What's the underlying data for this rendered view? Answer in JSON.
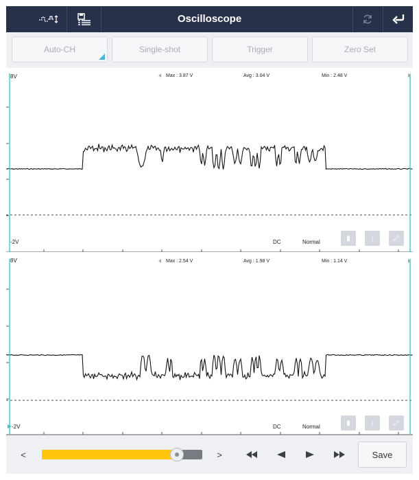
{
  "header": {
    "title": "Oscilloscope",
    "left_icons": [
      "waveform-icon",
      "data-list-icon"
    ],
    "right_icons": [
      "refresh-icon",
      "return-icon"
    ]
  },
  "toolbar": {
    "auto_ch": "Auto-CH",
    "single_shot": "Single-shot",
    "trigger": "Trigger",
    "zero_set": "Zero Set"
  },
  "channels": [
    {
      "top_label": "8V",
      "bottom_label": "-2V",
      "max": "Max : 3.87 V",
      "avg": "Avg : 3.04 V",
      "min": "Min : 2.48 V",
      "coupling": "DC",
      "mode": "Normal"
    },
    {
      "top_label": "8V",
      "bottom_label": "-2V",
      "max": "Max : 2.54 V",
      "avg": "Avg : 1.98 V",
      "min": "Min : 1.14 V",
      "coupling": "DC",
      "mode": "Normal"
    }
  ],
  "bottom": {
    "prev": "<",
    "next": ">",
    "save": "Save",
    "slider_progress": 0.84
  },
  "colors": {
    "header_bg": "#27324a",
    "marker": "#3ec9c4",
    "slider_fill": "#ffc60b",
    "accent": "#4bb4d4"
  }
}
